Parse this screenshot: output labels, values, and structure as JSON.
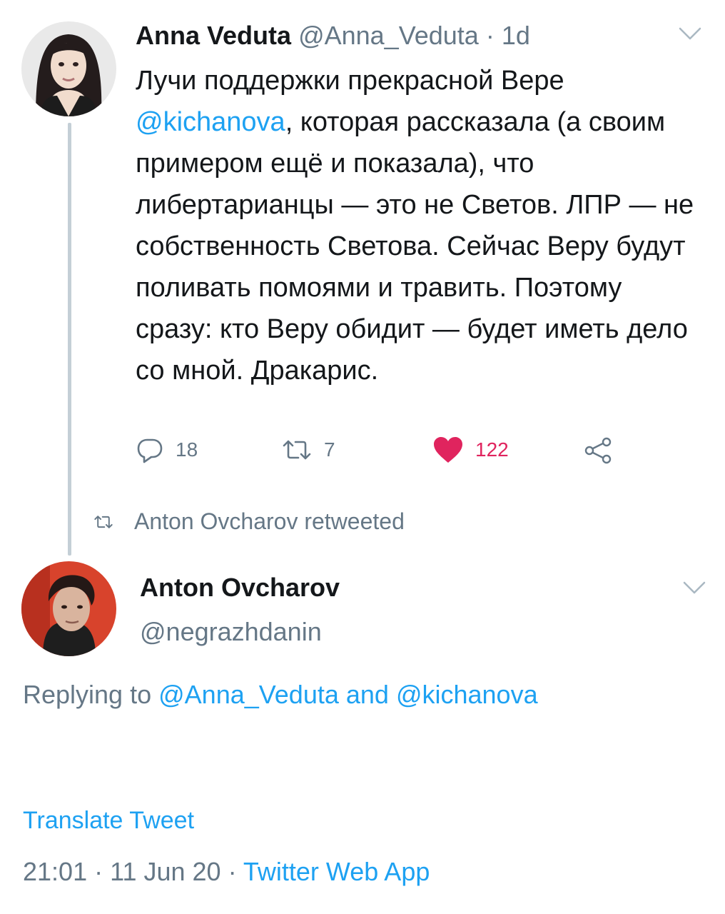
{
  "tweet1": {
    "display_name": "Anna Veduta",
    "handle": "@Anna_Veduta",
    "separator": " · ",
    "time": "1d",
    "text_before_mention": "Лучи поддержки прекрасной Вере",
    "mention": "@kichanova",
    "text_after_mention": ", которая рассказала (а своим примером ещё и показала), что либертарианцы — это не Светов. ЛПР — не собственность Светова. Сейчас Веру будут поливать помоями и травить. Поэтому сразу: кто Веру обидит — будет иметь дело со мной. Дракарис.",
    "reply_count": "18",
    "retweet_count": "7",
    "like_count": "122",
    "icons": {
      "reply": "reply-icon",
      "retweet": "retweet-icon",
      "like": "heart-icon",
      "share": "share-icon",
      "menu": "chevron-down-icon"
    },
    "like_color": "#e0245e"
  },
  "retweet_note": {
    "icon": "retweet-icon",
    "label": "Anton Ovcharov retweeted"
  },
  "tweet2": {
    "display_name": "Anton Ovcharov",
    "handle": "@negrazhdanin",
    "replying_prefix": "Replying to ",
    "replying_user1": "@Anna_Veduta",
    "replying_and": " and ",
    "replying_user2": "@kichanova",
    "body": "",
    "translate_label": "Translate Tweet",
    "time": "21:01",
    "separator": " · ",
    "date": "11 Jun 20",
    "source": "Twitter Web App"
  },
  "colors": {
    "link": "#1da1f2",
    "secondary_text": "#657786",
    "primary_text": "#14171a",
    "thread_line": "#c4cfd6"
  }
}
